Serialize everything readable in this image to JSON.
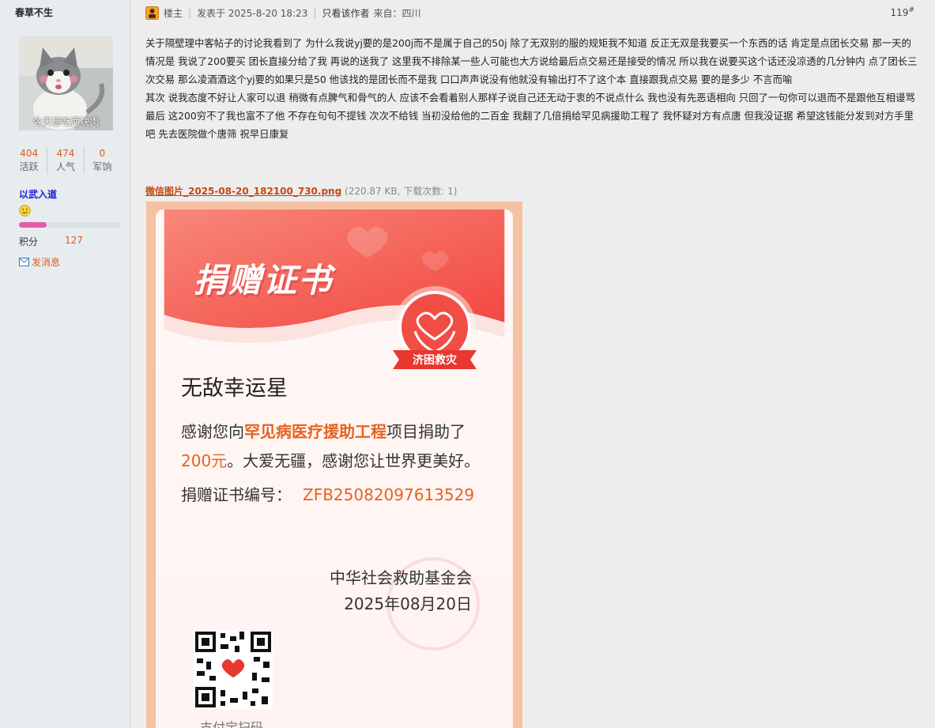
{
  "user": {
    "name": "春草不生",
    "avatar_caption": "今天想吃两块肉",
    "stats": [
      {
        "value": "404",
        "label": "活跃"
      },
      {
        "value": "474",
        "label": "人气"
      },
      {
        "value": "0",
        "label": "军饷"
      }
    ],
    "rank": "以武入道",
    "progress": 0.27,
    "points_label": "积分",
    "points_value": "127",
    "send_message": "发消息"
  },
  "post": {
    "role": "楼主",
    "posted": "发表于 2025-8-20 18:23",
    "only_author": "只看该作者",
    "location": "来自：四川",
    "floor": "119",
    "floor_mark": "#",
    "paragraphs": [
      "关于隔壁理中客帖子的讨论我看到了 为什么我说yj要的是200j而不是属于自己的50j 除了无双别的服的规矩我不知道 反正无双是我要买一个东西的话 肯定是点团长交易 那一天的情况是 我说了200要买 团长直接分给了我 再说的送我了 这里我不排除某一些人可能也大方说给最后点交易还是接受的情况 所以我在说要买这个话还没凉透的几分钟内 点了团长三次交易 那么凌酒酒这个yj要的如果只是50 他该找的是团长而不是我 口口声声说没有他就没有输出打不了这个本 直接跟我点交易 要的是多少 不言而喻",
      "其次 说我态度不好让人家可以退 稍微有点脾气和骨气的人 应该不会看着别人那样子说自己还无动于衷的不说点什么 我也没有先恶语相向 只回了一句你可以退而不是跟他互相谩骂",
      "最后 这200穷不了我也富不了他 不存在句句不提钱 次次不给钱 当初没给他的二百金 我翻了几倍捐给罕见病援助工程了  我怀疑对方有点唐 但我没证据 希望这钱能分发到对方手里吧 先去医院做个唐筛 祝早日康复"
    ],
    "attachment": {
      "filename": "微信图片_2025-08-20_182100_730.png",
      "info": "(220.87 KB, 下载次数: 1)"
    }
  },
  "certificate": {
    "title": "捐赠证书",
    "badge": "济困救灾",
    "recipient": "无敌幸运星",
    "line1_pre": "感谢您向",
    "project": "罕见病医疗援助工程",
    "line1_post": "项目捐助了",
    "amount": "200元",
    "line2_post": "。大爱无疆，感谢您让世界更美好。",
    "certno_label": "捐赠证书编号：",
    "certno": "ZFB25082097613529",
    "org": "中华社会救助基金会",
    "date": "2025年08月20日",
    "qr_label": "支付宝扫码"
  },
  "colors": {
    "accent": "#e05a1a",
    "link": "#c44810",
    "rank": "#1c1cd6",
    "cert_red": "#f3574d"
  }
}
